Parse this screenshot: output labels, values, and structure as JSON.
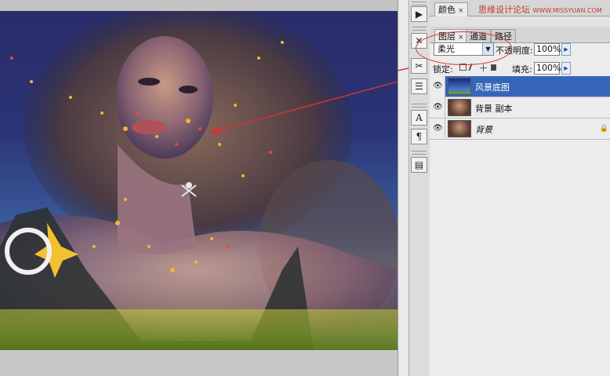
{
  "panel_tabs_top": [
    {
      "label": "颜色",
      "close": "×"
    }
  ],
  "watermark": {
    "text": "思缘设计论坛",
    "url": "WWW.MISSYUAN.COM"
  },
  "layer_tabs": [
    {
      "label": "图层",
      "close": "×"
    },
    {
      "label": "通道"
    },
    {
      "label": "路径"
    }
  ],
  "blend": {
    "mode": "柔光",
    "arrow": "▼"
  },
  "opacity": {
    "label": "不透明度:",
    "value": "100%",
    "arrow": "▶"
  },
  "lock": {
    "label": "锁定:"
  },
  "fill": {
    "label": "填充:",
    "value": "100%",
    "arrow": "▶"
  },
  "layers": [
    {
      "name": "风景底图",
      "selected": true
    },
    {
      "name": "背景 副本",
      "selected": false
    },
    {
      "name": "背景",
      "selected": false,
      "italic": true
    }
  ],
  "tools": [
    {
      "glyph": "▶",
      "icon": "play-icon"
    },
    {
      "glyph": "✕",
      "icon": "tools-icon"
    },
    {
      "glyph": "✂",
      "icon": "clone-icon"
    },
    {
      "glyph": "☰",
      "icon": "brush-list-icon"
    },
    {
      "glyph": "A",
      "icon": "character-icon"
    },
    {
      "glyph": "¶",
      "icon": "paragraph-icon"
    },
    {
      "glyph": "▤",
      "icon": "layer-comps-icon"
    }
  ],
  "colors": {
    "selected_row": "#3566b8",
    "annotation": "#d33333"
  }
}
